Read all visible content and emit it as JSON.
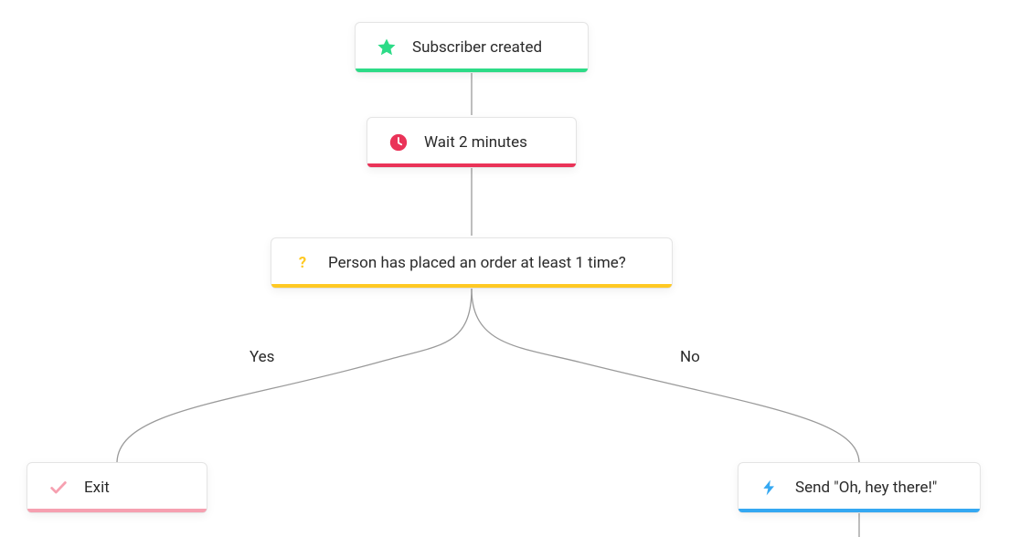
{
  "nodes": {
    "trigger": {
      "label": "Subscriber created",
      "accent": "#2ddb87",
      "icon": "star"
    },
    "wait": {
      "label": "Wait 2 minutes",
      "accent": "#ea3358",
      "icon": "clock"
    },
    "condition": {
      "label": "Person has placed an order at least 1 time?",
      "accent": "#ffc923",
      "icon": "question"
    },
    "exit": {
      "label": "Exit",
      "accent": "#f6a0b0",
      "icon": "check"
    },
    "send": {
      "label": "Send \"Oh, hey there!\"",
      "accent": "#34a8f2",
      "icon": "bolt"
    }
  },
  "branches": {
    "yes": "Yes",
    "no": "No"
  }
}
